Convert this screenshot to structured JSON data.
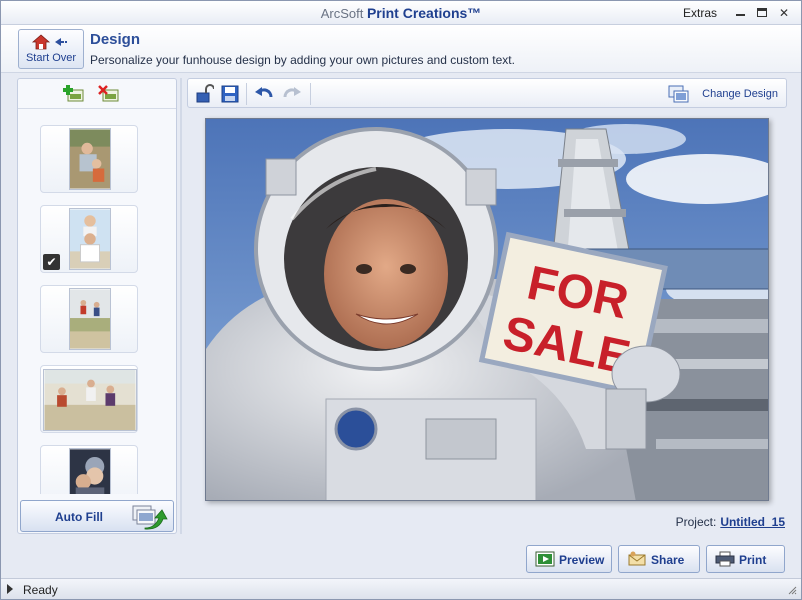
{
  "window": {
    "title_brand": "ArcSoft",
    "title_product": "Print Creations™",
    "extras_label": "Extras"
  },
  "header": {
    "start_over_label": "Start Over",
    "title": "Design",
    "subtitle": "Personalize your funhouse design by adding your own pictures and custom text."
  },
  "left_panel": {
    "auto_fill_label": "Auto Fill",
    "thumbnails": [
      {
        "name": "photo-1",
        "selected": false
      },
      {
        "name": "photo-2",
        "selected": true
      },
      {
        "name": "photo-3",
        "selected": false
      },
      {
        "name": "photo-4",
        "selected": false
      },
      {
        "name": "photo-5",
        "selected": false
      }
    ]
  },
  "toolbar": {
    "change_design_label": "Change Design",
    "icons": [
      "unlock-icon",
      "save-icon",
      "undo-icon",
      "redo-icon"
    ]
  },
  "canvas": {
    "sign_line1": "FOR",
    "sign_line2": "SALE"
  },
  "footer": {
    "project_label": "Project:",
    "project_name": "Untitled_15",
    "preview_label": "Preview",
    "share_label": "Share",
    "print_label": "Print"
  },
  "status": {
    "text": "Ready"
  },
  "colors": {
    "accent": "#1f3f8f",
    "header_title": "#2d4f9a",
    "sign_text": "#c8202a"
  }
}
